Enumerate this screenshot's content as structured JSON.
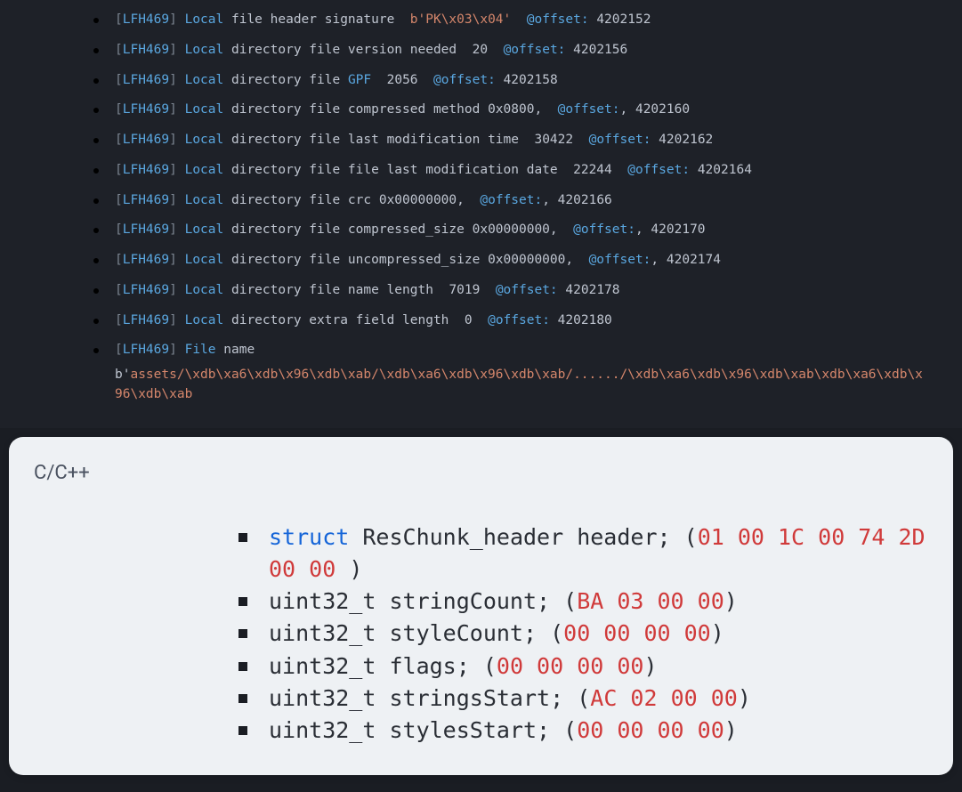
{
  "log": {
    "tag": "LFH469",
    "entries": [
      {
        "kw": "Local",
        "desc": "file header signature",
        "literal": "b'PK\\x03\\x04'",
        "offsetLabel": "@offset:",
        "offsetVal": "4202152"
      },
      {
        "kw": "Local",
        "desc": "directory file version needed",
        "num": "20",
        "offsetLabel": "@offset:",
        "offsetVal": "4202156"
      },
      {
        "kw": "Local",
        "desc": "directory file",
        "extraKw": "GPF",
        "num": "2056",
        "offsetLabel": "@offset:",
        "offsetVal": "4202158"
      },
      {
        "kw": "Local",
        "desc": "directory file compressed method 0x0800,",
        "offsetLabel": "@offset:",
        "postComma": ",",
        "offsetVal": "4202160"
      },
      {
        "kw": "Local",
        "desc": "directory file last modification time",
        "num": "30422",
        "offsetLabel": "@offset:",
        "offsetVal": "4202162"
      },
      {
        "kw": "Local",
        "desc": "directory file file last modification date",
        "num": "22244",
        "offsetLabel": "@offset:",
        "offsetVal": "4202164"
      },
      {
        "kw": "Local",
        "desc": "directory file crc 0x00000000,",
        "offsetLabel": "@offset:",
        "postComma": ",",
        "offsetVal": "4202166"
      },
      {
        "kw": "Local",
        "desc": "directory file compressed_size 0x00000000,",
        "offsetLabel": "@offset:",
        "postComma": ",",
        "offsetVal": "4202170"
      },
      {
        "kw": "Local",
        "desc": "directory file uncompressed_size 0x00000000,",
        "offsetLabel": "@offset:",
        "postComma": ",",
        "offsetVal": "4202174"
      },
      {
        "kw": "Local",
        "desc": "directory file name length",
        "num": "7019",
        "offsetLabel": "@offset:",
        "offsetVal": "4202178"
      },
      {
        "kw": "Local",
        "desc": "directory extra field length",
        "num": "0",
        "offsetLabel": "@offset:",
        "offsetVal": "4202180"
      },
      {
        "kw": "File",
        "desc": "name",
        "filename": {
          "prefix": "b'",
          "body": "assets/\\xdb\\xa6\\xdb\\x96\\xdb\\xab/\\xdb\\xa6\\xdb\\x96\\xdb\\xab/....../\\xdb\\xa6\\xdb\\x96\\xdb\\xab\\xdb\\xa6\\xdb\\x96\\xdb\\xab"
        }
      }
    ]
  },
  "code": {
    "lang": "C/C++",
    "fields": [
      {
        "kw": "struct",
        "type": "ResChunk_header header;",
        "hex": "01 00 1C 00 74 2D 00 00 "
      },
      {
        "type": "uint32_t stringCount; (BA",
        "hex": "03 00 00",
        "prefixPlain": "uint32_t stringCount;",
        "hexFull": "BA 03 00 00"
      },
      {
        "prefixPlain": "uint32_t styleCount;",
        "hexFull": "00 00 00 00"
      },
      {
        "prefixPlain": "uint32_t flags;",
        "hexFull": "00 00 00 00"
      },
      {
        "prefixPlain": "uint32_t stringsStart;",
        "hexFull": "AC 02 00 00"
      },
      {
        "prefixPlain": "uint32_t stylesStart;",
        "hexFull": "00 00 00 00"
      }
    ]
  }
}
